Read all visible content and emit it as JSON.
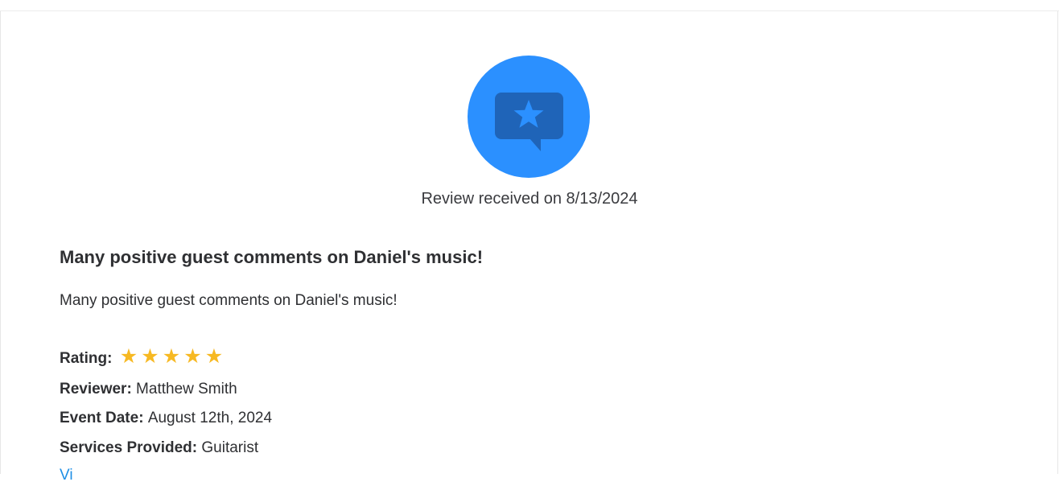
{
  "header": {
    "received_text": "Review received on 8/13/2024",
    "icon": "review-star-bubble-icon",
    "accent_color": "#2b90ff"
  },
  "review": {
    "title": "Many positive guest comments on Daniel's music!",
    "body": "Many positive guest comments on Daniel's music!"
  },
  "details": {
    "rating_label": "Rating:",
    "rating_value": 5,
    "rating_max": 5,
    "star_glyph": "★",
    "star_color": "#f7b923",
    "reviewer_label": "Reviewer:",
    "reviewer_value": "Matthew Smith",
    "event_date_label": "Event Date:",
    "event_date_value": "August 12th, 2024",
    "services_label": "Services Provided:",
    "services_value": "Guitarist"
  },
  "footer": {
    "link_text": "Vi"
  }
}
